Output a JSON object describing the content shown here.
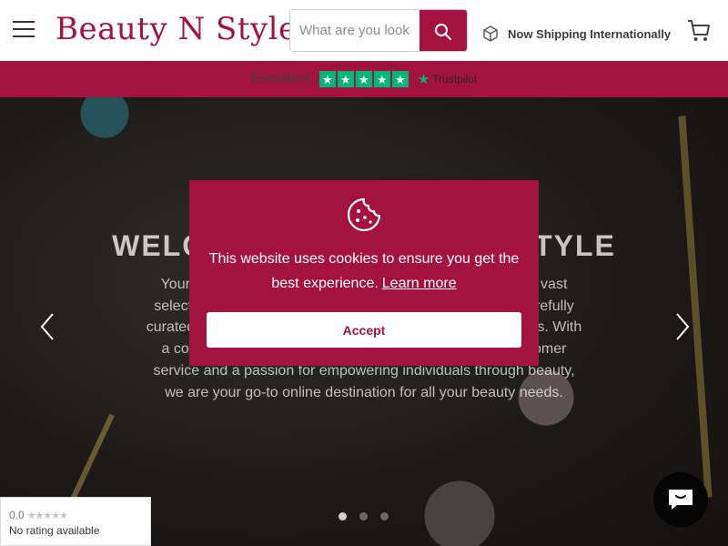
{
  "header": {
    "logo_text": "Beauty N Style",
    "search": {
      "placeholder": "What are you looking for?"
    },
    "shipping_text": "Now Shipping Internationally",
    "icons": {
      "menu": "menu-icon",
      "search": "search-icon",
      "shipping": "box-icon",
      "cart": "cart-icon"
    }
  },
  "trustbar": {
    "rating_label": "Excellent",
    "stars": 5,
    "brand": "Trustpilot"
  },
  "hero": {
    "title": "WELCOME TO BEAUTY N STYLE",
    "text": "Your one-stop destination for beauty products. Explore our vast selection of cosmetics, skincare, and hair care products, carefully curated to bring you the latest in beauty innovation and trends. With a commitment to quality and affordability, exceptional customer service and a passion for empowering individuals through beauty, we are your go-to online destination for all your beauty needs.",
    "slides": 3,
    "active_slide": 1
  },
  "cookie": {
    "message": "This website uses cookies to ensure you get the best experience.",
    "learn_more": "Learn more",
    "accept_label": "Accept"
  },
  "google_badge": {
    "score": "0.0",
    "status": "No rating available"
  },
  "colors": {
    "brand": "#a4123f",
    "trustpilot_green": "#00b67a"
  }
}
